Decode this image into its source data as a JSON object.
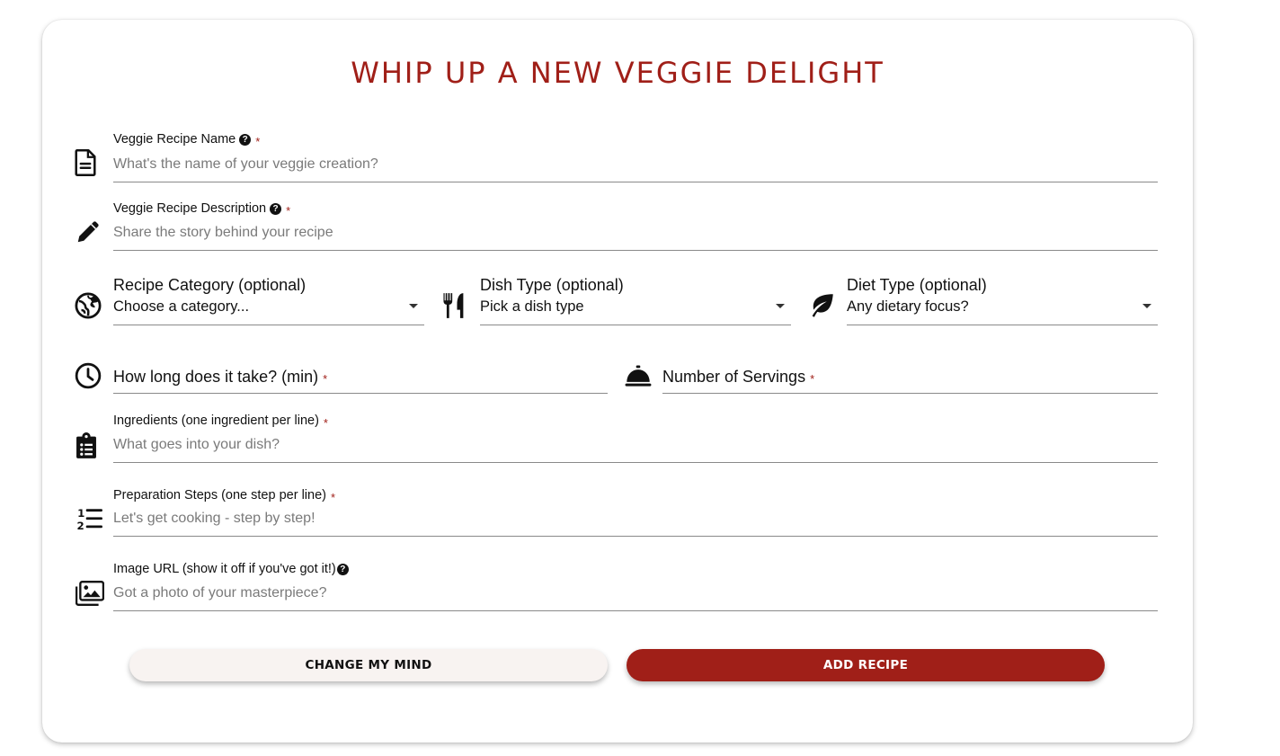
{
  "form": {
    "title": "WHIP UP A NEW VEGGIE DELIGHT",
    "required_mark": "*",
    "help_mark": "?",
    "recipe_name": {
      "label": "Veggie Recipe Name",
      "placeholder": "What's the name of your veggie creation?",
      "value": "",
      "icon": "document-icon"
    },
    "description": {
      "label": "Veggie Recipe Description",
      "placeholder": "Share the story behind your recipe",
      "value": "",
      "icon": "pencil-icon"
    },
    "category": {
      "label": "Recipe Category (optional)",
      "selected": "Choose a category...",
      "icon": "globe-icon"
    },
    "dish_type": {
      "label": "Dish Type (optional)",
      "selected": "Pick a dish type",
      "icon": "utensils-icon"
    },
    "diet_type": {
      "label": "Diet Type (optional)",
      "selected": "Any dietary focus?",
      "icon": "leaf-icon"
    },
    "time": {
      "label": "How long does it take? (min)",
      "value": "",
      "icon": "clock-icon"
    },
    "servings": {
      "label": "Number of Servings",
      "value": "",
      "icon": "service-bell-icon"
    },
    "ingredients": {
      "label": "Ingredients (one ingredient per line)",
      "placeholder": "What goes into your dish?",
      "value": "",
      "icon": "clipboard-list-icon"
    },
    "steps": {
      "label": "Preparation Steps (one step per line)",
      "placeholder": "Let's get cooking - step by step!",
      "value": "",
      "icon": "numbered-list-icon"
    },
    "image_url": {
      "label": "Image URL (show it off if you've got it!)",
      "placeholder": "Got a photo of your masterpiece?",
      "value": "",
      "icon": "images-icon"
    },
    "buttons": {
      "cancel": "CHANGE MY MIND",
      "submit": "ADD RECIPE"
    }
  },
  "colors": {
    "accent": "#a01f18",
    "cancel_bg": "#f8f3f1"
  }
}
